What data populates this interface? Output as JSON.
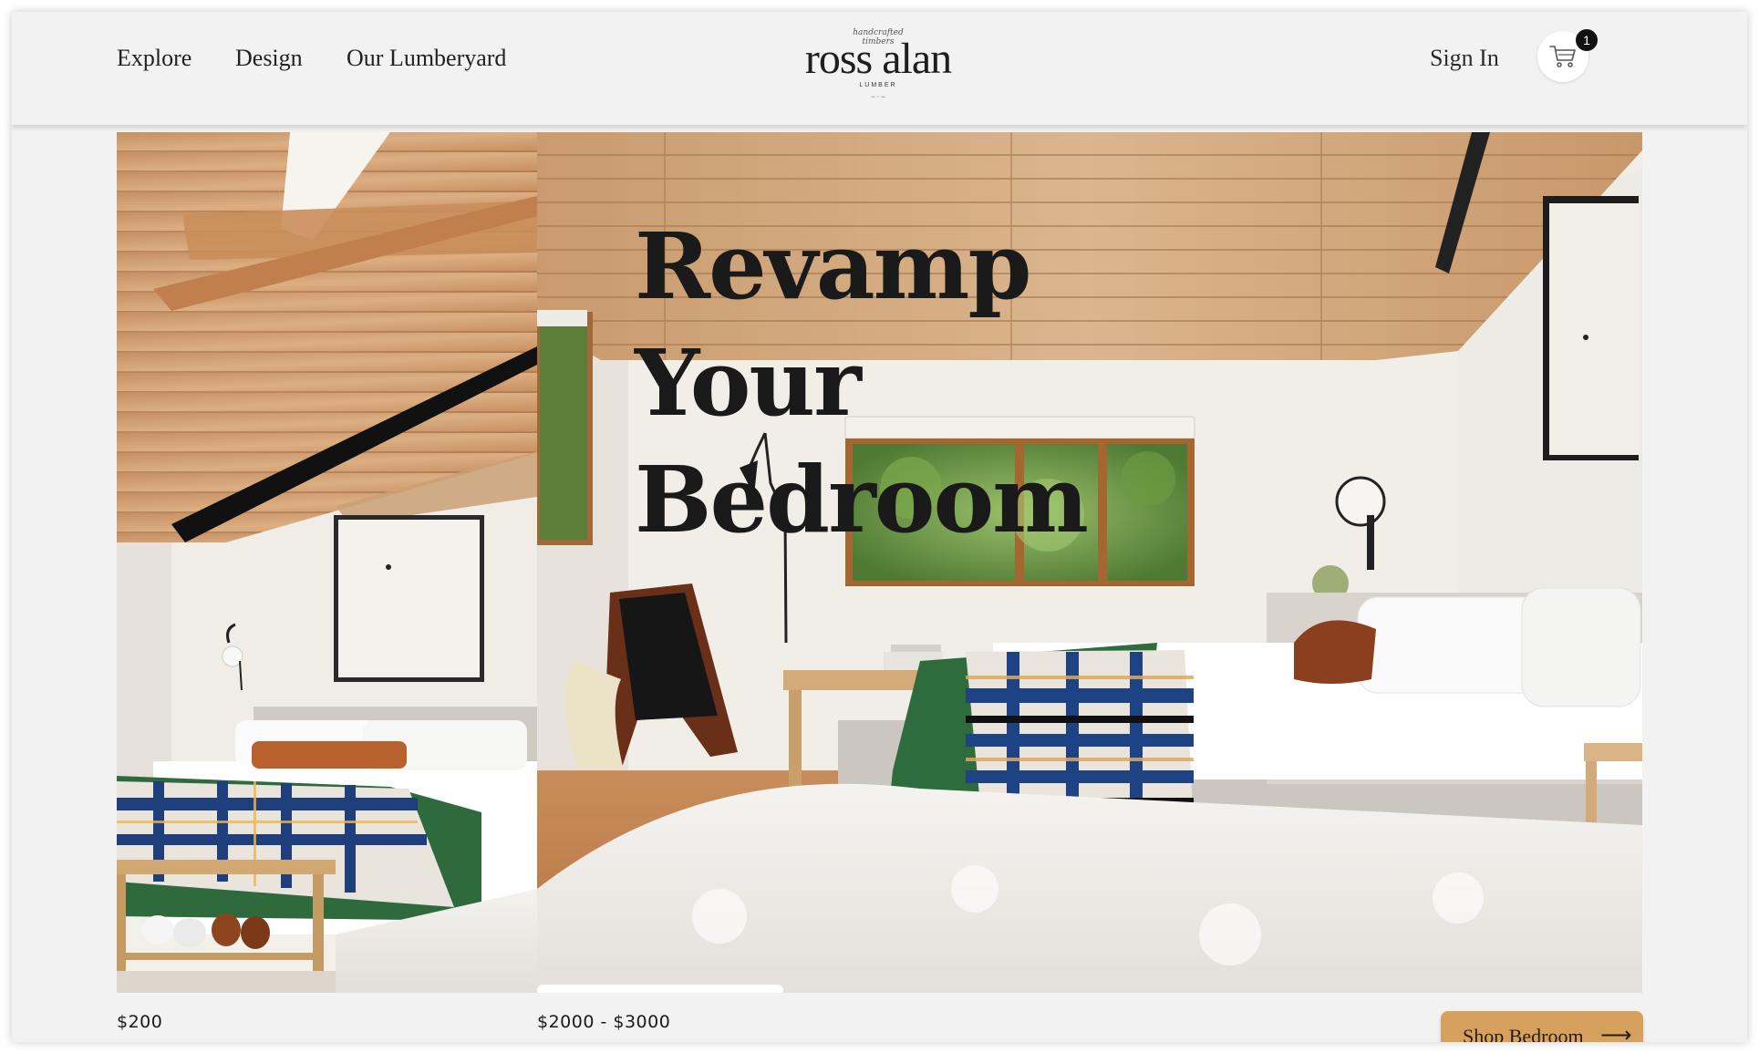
{
  "header": {
    "nav": [
      {
        "label": "Explore"
      },
      {
        "label": "Design"
      },
      {
        "label": "Our Lumberyard"
      }
    ],
    "logo": {
      "tagline": "handcrafted timbers",
      "name": "ross alan",
      "sub": "LUMBER"
    },
    "sign_in": "Sign In",
    "cart": {
      "icon": "cart-icon",
      "count": "1"
    }
  },
  "hero": {
    "title_line1": "Revamp Your",
    "title_line2": "Bedroom"
  },
  "products": [
    {
      "price": "$200",
      "image": "attic bedroom with cedar ceiling"
    },
    {
      "price": "$2000 - $3000",
      "image": "bedroom with wood-plank ceiling and window"
    }
  ],
  "cta": {
    "label": "Shop Bedroom",
    "icon": "arrow-right-icon"
  },
  "colors": {
    "background": "#f2f2f2",
    "cta": "#d6a15c",
    "badge": "#111111"
  }
}
